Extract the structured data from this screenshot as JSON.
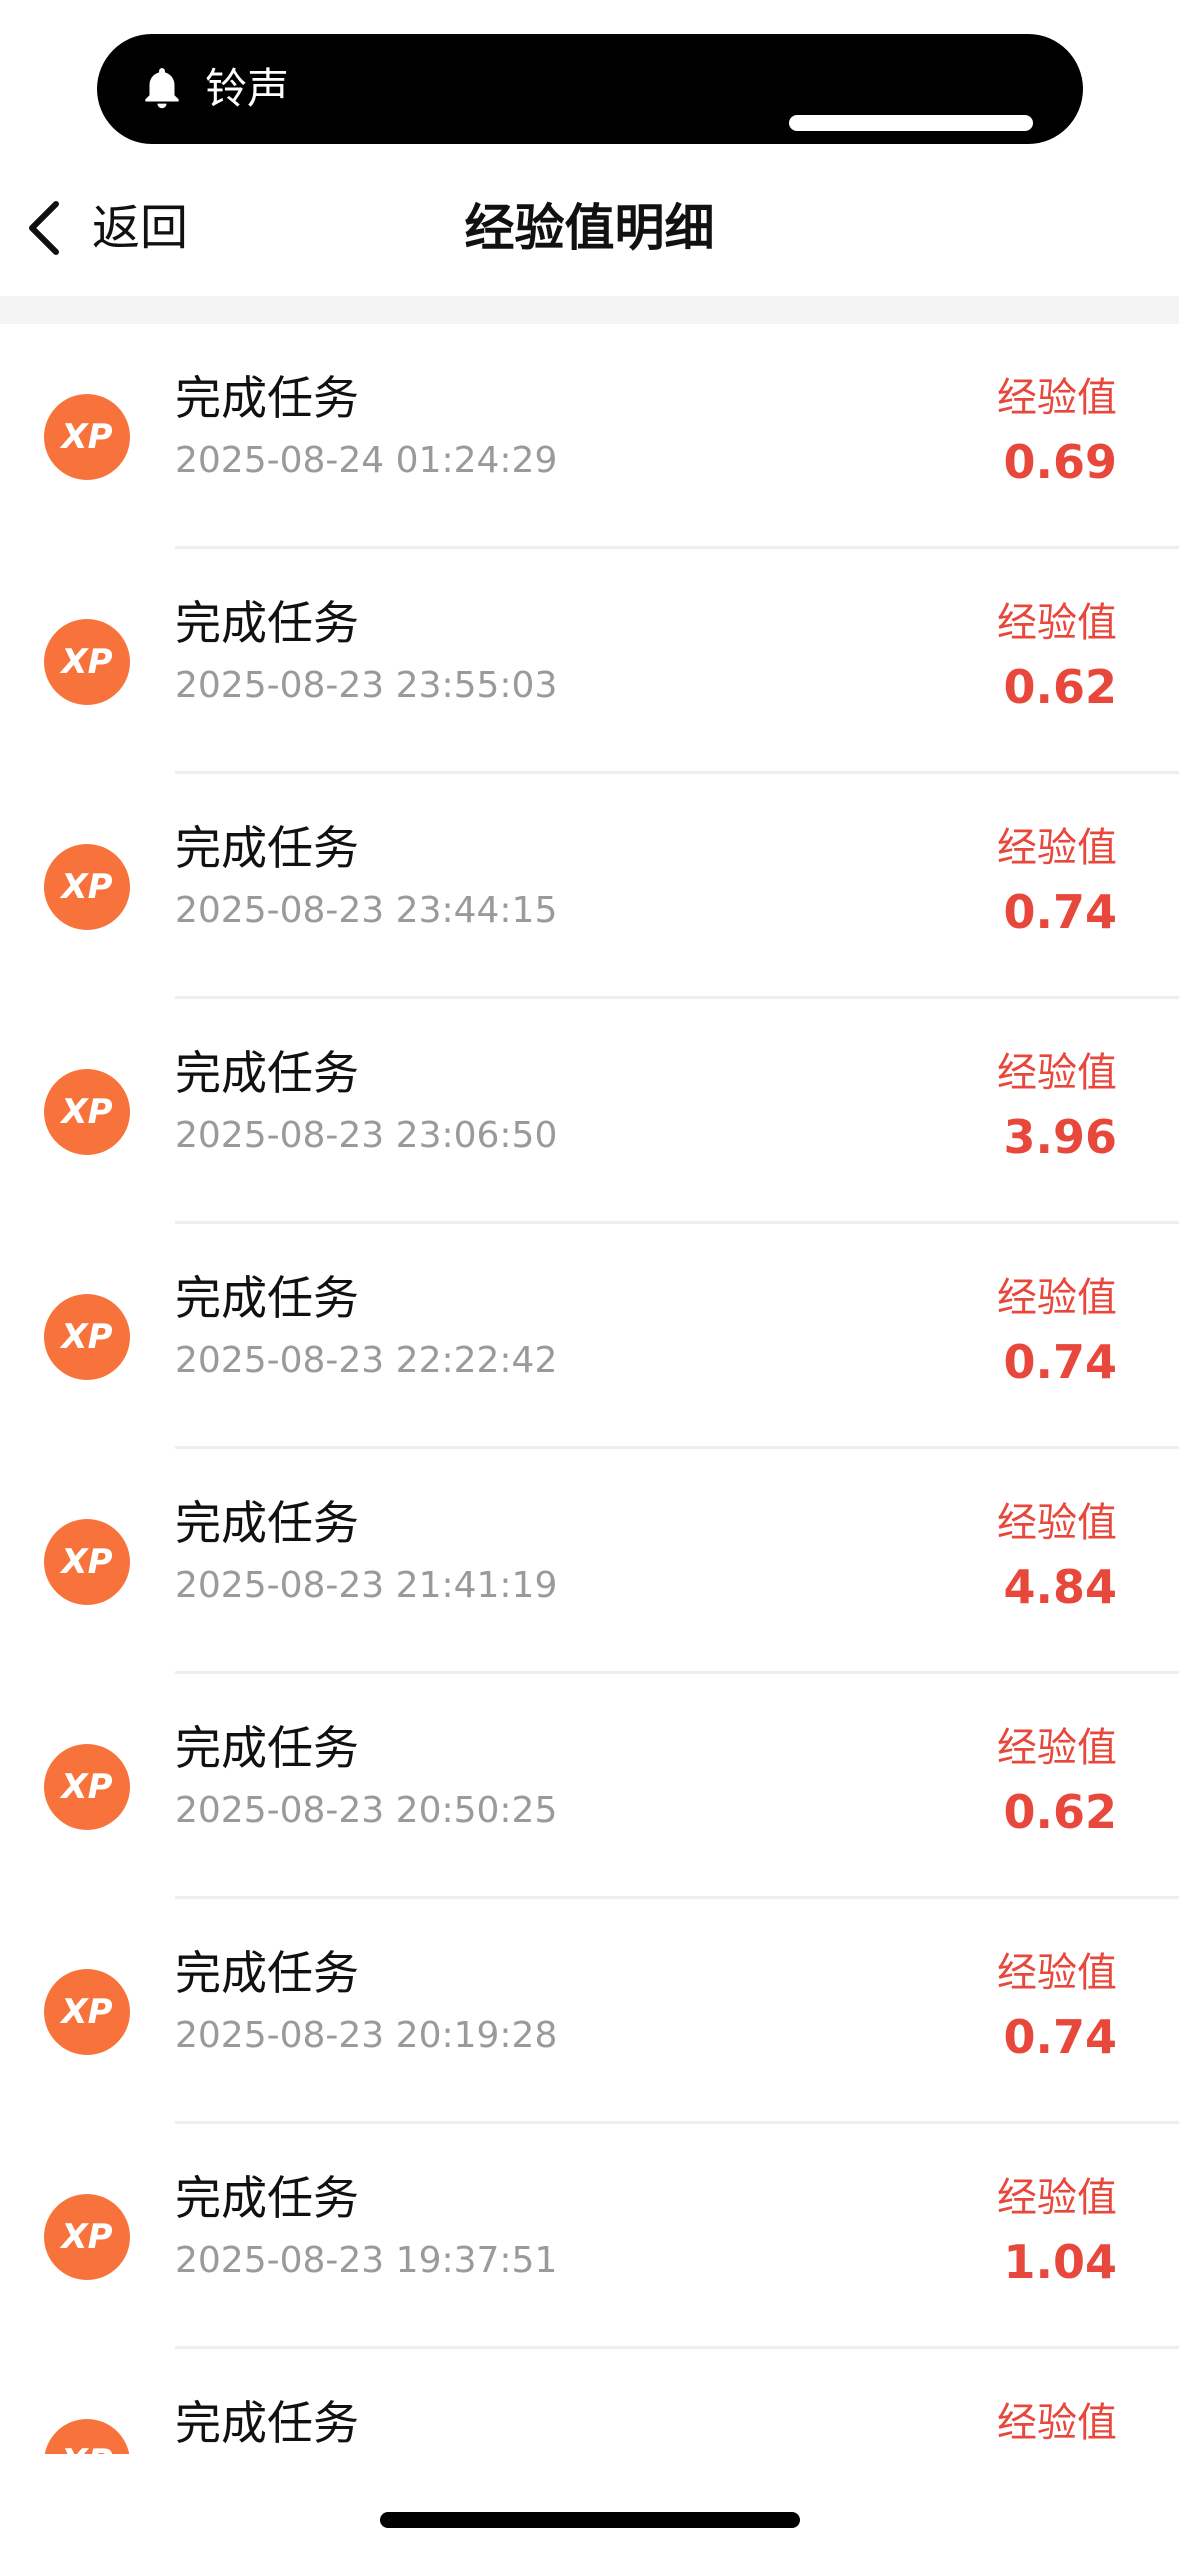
{
  "ringer": {
    "label": "铃声",
    "icon": "bell-icon"
  },
  "nav": {
    "back_label": "返回",
    "title": "经验值明细",
    "back_icon": "chevron-left-icon"
  },
  "colors": {
    "accent_red": "#e8473c",
    "badge_orange": "#f7733b",
    "time_gray": "#9a9a9a"
  },
  "records": [
    {
      "badge": "XP",
      "title": "完成任务",
      "time": "2025-08-24 01:24:29",
      "exp_label": "经验值",
      "exp_value": "0.69"
    },
    {
      "badge": "XP",
      "title": "完成任务",
      "time": "2025-08-23 23:55:03",
      "exp_label": "经验值",
      "exp_value": "0.62"
    },
    {
      "badge": "XP",
      "title": "完成任务",
      "time": "2025-08-23 23:44:15",
      "exp_label": "经验值",
      "exp_value": "0.74"
    },
    {
      "badge": "XP",
      "title": "完成任务",
      "time": "2025-08-23 23:06:50",
      "exp_label": "经验值",
      "exp_value": "3.96"
    },
    {
      "badge": "XP",
      "title": "完成任务",
      "time": "2025-08-23 22:22:42",
      "exp_label": "经验值",
      "exp_value": "0.74"
    },
    {
      "badge": "XP",
      "title": "完成任务",
      "time": "2025-08-23 21:41:19",
      "exp_label": "经验值",
      "exp_value": "4.84"
    },
    {
      "badge": "XP",
      "title": "完成任务",
      "time": "2025-08-23 20:50:25",
      "exp_label": "经验值",
      "exp_value": "0.62"
    },
    {
      "badge": "XP",
      "title": "完成任务",
      "time": "2025-08-23 20:19:28",
      "exp_label": "经验值",
      "exp_value": "0.74"
    },
    {
      "badge": "XP",
      "title": "完成任务",
      "time": "2025-08-23 19:37:51",
      "exp_label": "经验值",
      "exp_value": "1.04"
    },
    {
      "badge": "XP",
      "title": "完成任务",
      "time": "",
      "exp_label": "经验值",
      "exp_value": ""
    }
  ]
}
